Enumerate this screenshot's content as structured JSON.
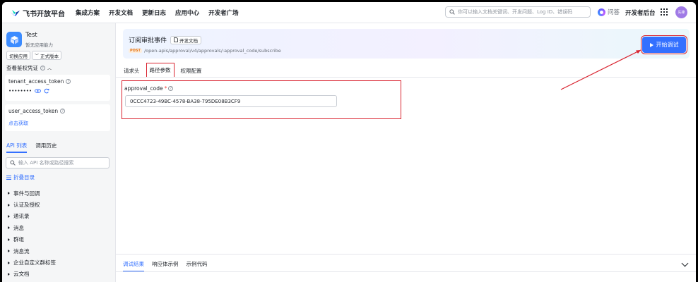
{
  "topnav": {
    "brand": "飞书开放平台",
    "links": [
      "集成方案",
      "开发文档",
      "更新日志",
      "应用中心",
      "开发者广场"
    ],
    "search_placeholder": "你可以输入文档关键词、开发问题、Log ID、错误码",
    "ask_label": "问答",
    "dev_console": "开发者后台",
    "avatar_text": "先锋"
  },
  "sidebar": {
    "app_name": "Test",
    "app_desc": "暂无应用能力",
    "switch_app": "切换应用",
    "version": "正式版本",
    "credentials_title": "查看鉴权凭证",
    "tenant_token_label": "tenant_access_token",
    "tenant_token_value": "••••••••",
    "user_token_label": "user_access_token",
    "user_token_action": "点击获取",
    "tabs": [
      "API 列表",
      "调用历史"
    ],
    "search_placeholder": "输入 API 名称或路径搜索",
    "collapse_label": "折叠目录",
    "categories": [
      "事件与回调",
      "认证及授权",
      "通讯录",
      "消息",
      "群组",
      "消息流",
      "企业自定义群标签",
      "云文档",
      "日历"
    ]
  },
  "main": {
    "api_title": "订阅审批事件",
    "doc_chip": "开发文档",
    "method": "POST",
    "path": "/open-apis/approval/v4/approvals/:approval_code/subscribe",
    "start_button": "开始调试",
    "tabs": [
      "请求头",
      "路径参数",
      "权限配置"
    ],
    "param_label": "approval_code",
    "param_required": "*",
    "param_value": "0CCC4723-49BC-4578-BA38-795DE08B3CF9",
    "bottom_tabs": [
      "调试结果",
      "响应体示例",
      "示例代码"
    ]
  },
  "colors": {
    "accent": "#3370ff",
    "annotation": "#d9232f",
    "avatar": "#a07ae6"
  }
}
